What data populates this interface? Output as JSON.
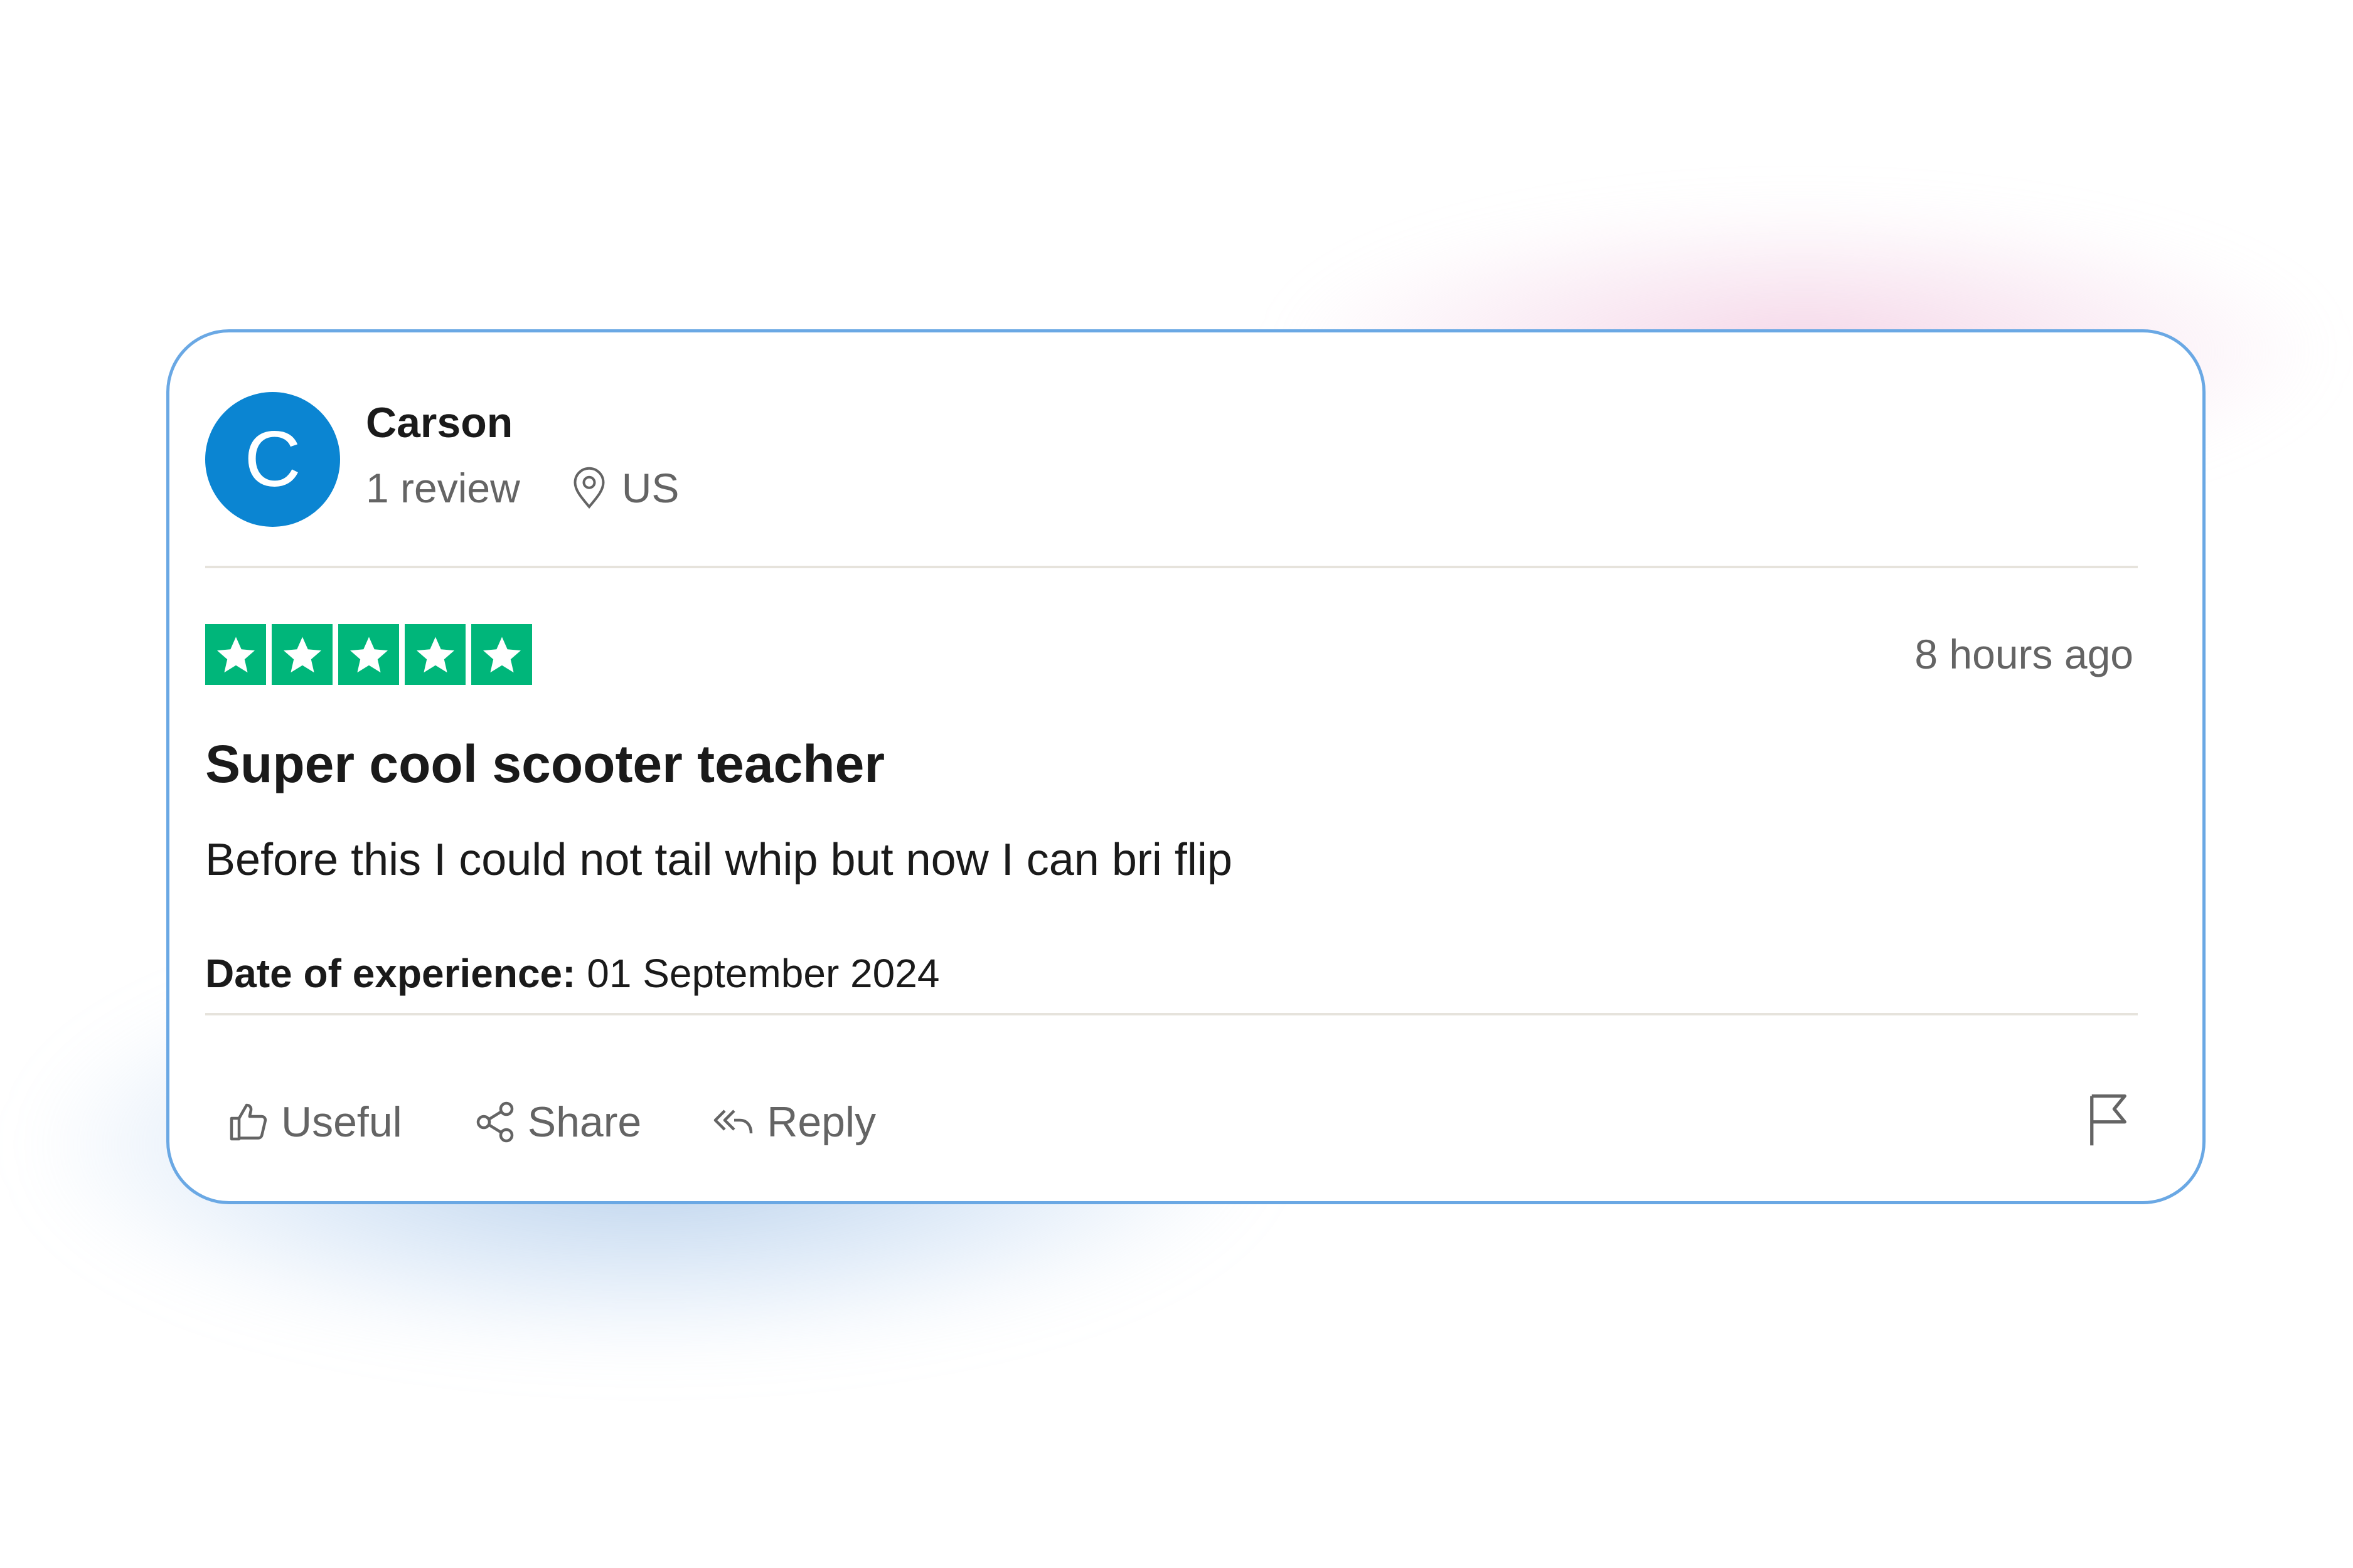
{
  "review": {
    "reviewer": {
      "initial": "C",
      "name": "Carson",
      "review_count": "1 review",
      "country": "US",
      "avatar_color": "#0b85d2"
    },
    "rating": {
      "stars": 5,
      "max_stars": 5,
      "star_color": "#00b67a"
    },
    "time_ago": "8 hours ago",
    "title": "Super cool scooter teacher",
    "body": "Before this I could not tail whip but now I can bri flip",
    "experience_label": "Date of experience:",
    "experience_date": "01 September 2024",
    "actions": {
      "useful_label": "Useful",
      "share_label": "Share",
      "reply_label": "Reply"
    }
  },
  "icons": {
    "location": "location-pin-icon",
    "star": "star-icon",
    "useful": "thumbs-up-icon",
    "share": "share-icon",
    "reply": "reply-icon",
    "report": "flag-icon"
  },
  "colors": {
    "card_border": "#6aa8e4",
    "muted_text": "#646464",
    "divider": "#e6e3dc"
  }
}
